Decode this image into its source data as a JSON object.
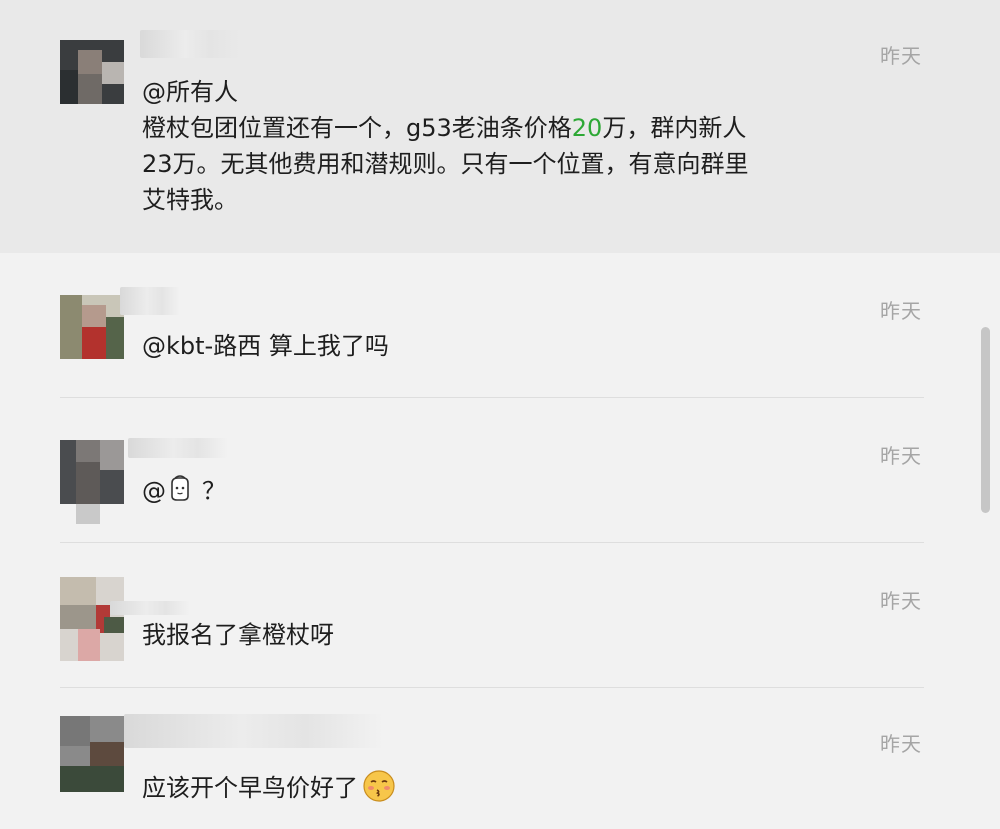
{
  "messages": [
    {
      "time": "昨天",
      "line1": "@所有人",
      "line2_pre": "橙杖包团位置还有一个，g53老油条价格",
      "line2_highlight": "20",
      "line2_post": "万，群内新人",
      "line3": "23万。无其他费用和潜规则。只有一个位置，有意向群里",
      "line4": "艾特我。"
    },
    {
      "time": "昨天",
      "text": "@kbt-路西 算上我了吗"
    },
    {
      "time": "昨天",
      "text_pre": "@",
      "text_post": "？",
      "emoji": "face-emoji-icon"
    },
    {
      "time": "昨天",
      "text": "我报名了拿橙杖呀"
    },
    {
      "time": "昨天",
      "text": "应该开个早鸟价好了",
      "emoji": "blushing-kiss-emoji-icon"
    }
  ],
  "colors": {
    "highlight": "#2da835",
    "time": "#a5a5a5",
    "selected_row": "#e9e9e9",
    "background": "#f2f2f2"
  }
}
